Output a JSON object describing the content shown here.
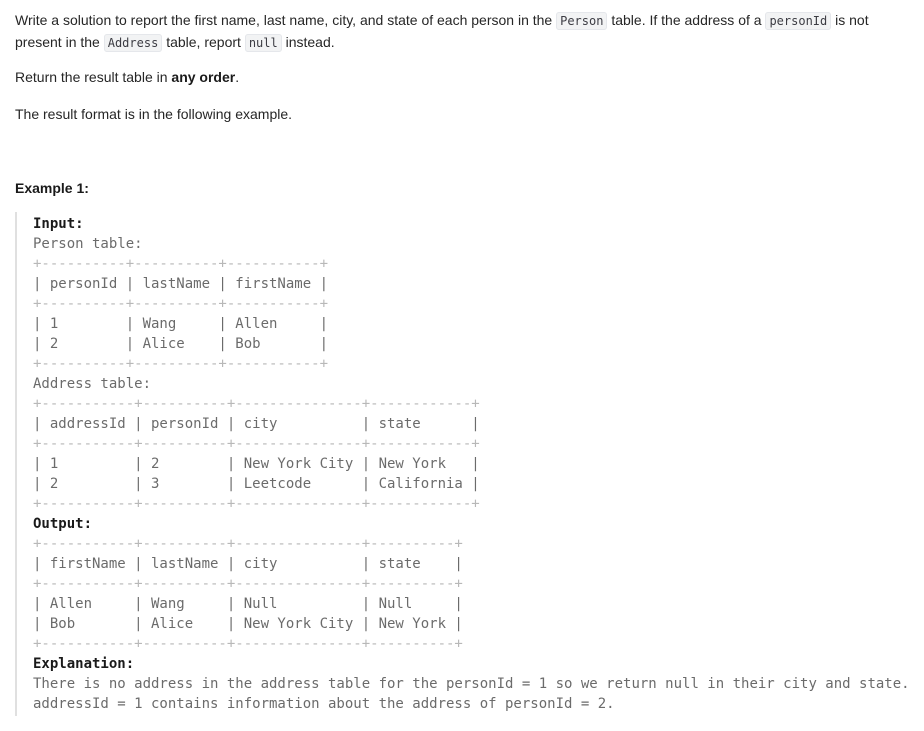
{
  "description": {
    "p1_a": "Write a solution to report the first name, last name, city, and state of each person in the ",
    "p1_code1": "Person",
    "p1_b": " table. If the address of a ",
    "p1_code2": "personId",
    "p1_c": " is not present in the ",
    "p1_code3": "Address",
    "p1_d": " table, report ",
    "p1_code4": "null",
    "p1_e": " instead.",
    "p2_a": "Return the result table in ",
    "p2_bold": "any order",
    "p2_b": ".",
    "p3": "The result format is in the following example."
  },
  "example": {
    "title": "Example 1:",
    "input_label": "Input:",
    "person_table_label": "Person table:",
    "person_table": [
      "+----------+----------+-----------+",
      "| personId | lastName | firstName |",
      "+----------+----------+-----------+",
      "| 1        | Wang     | Allen     |",
      "| 2        | Alice    | Bob       |",
      "+----------+----------+-----------+"
    ],
    "address_table_label": "Address table:",
    "address_table": [
      "+-----------+----------+---------------+------------+",
      "| addressId | personId | city          | state      |",
      "+-----------+----------+---------------+------------+",
      "| 1         | 2        | New York City | New York   |",
      "| 2         | 3        | Leetcode      | California |",
      "+-----------+----------+---------------+------------+"
    ],
    "output_label": "Output:",
    "output_table": [
      "+-----------+----------+---------------+----------+",
      "| firstName | lastName | city          | state    |",
      "+-----------+----------+---------------+----------+",
      "| Allen     | Wang     | Null          | Null     |",
      "| Bob       | Alice    | New York City | New York |",
      "+-----------+----------+---------------+----------+"
    ],
    "explanation_label": "Explanation:",
    "explanation_lines": [
      "There is no address in the address table for the personId = 1 so we return null in their city and state.",
      "addressId = 1 contains information about the address of personId = 2."
    ]
  }
}
